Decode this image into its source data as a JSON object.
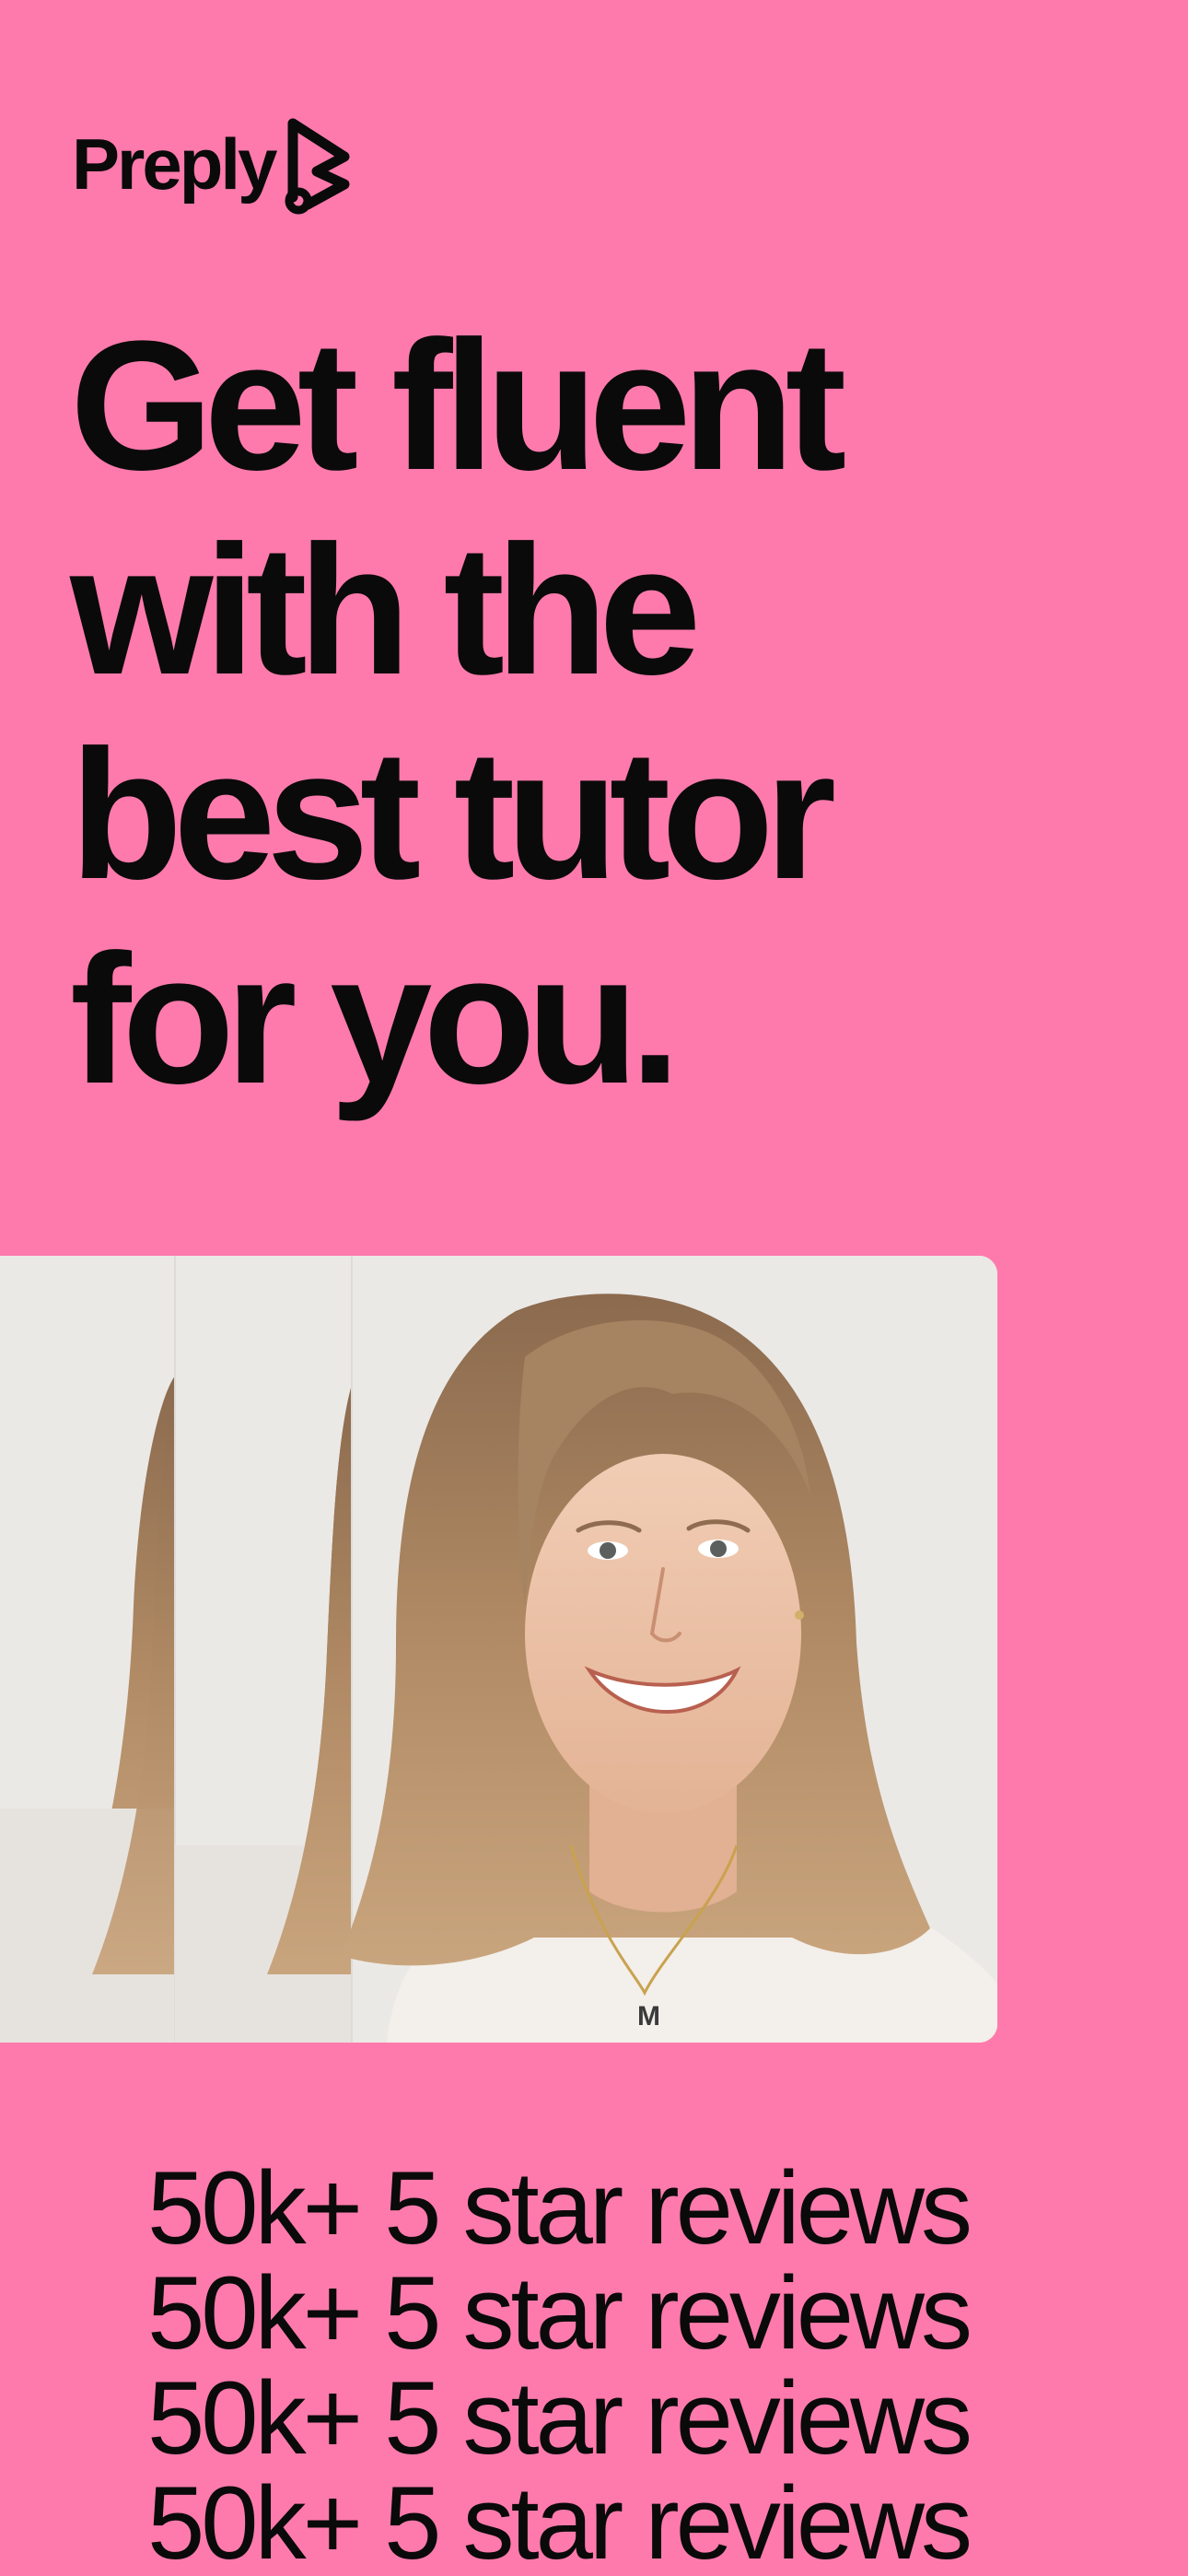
{
  "brand": {
    "name": "Preply",
    "logo_icon": "preply-logo-mark-icon",
    "background_color": "#FF7AAC",
    "text_color": "#0A0A0A"
  },
  "headline": {
    "lines": [
      "Get fluent",
      "with the",
      "best tutor",
      "for you."
    ]
  },
  "tutor_photo": {
    "name": "tutor-photo",
    "monogram": "M"
  },
  "reviews": {
    "lines": [
      "50k+ 5 star reviews",
      "50k+ 5 star reviews",
      "50k+ 5 star reviews",
      "50k+ 5 star reviews"
    ]
  }
}
